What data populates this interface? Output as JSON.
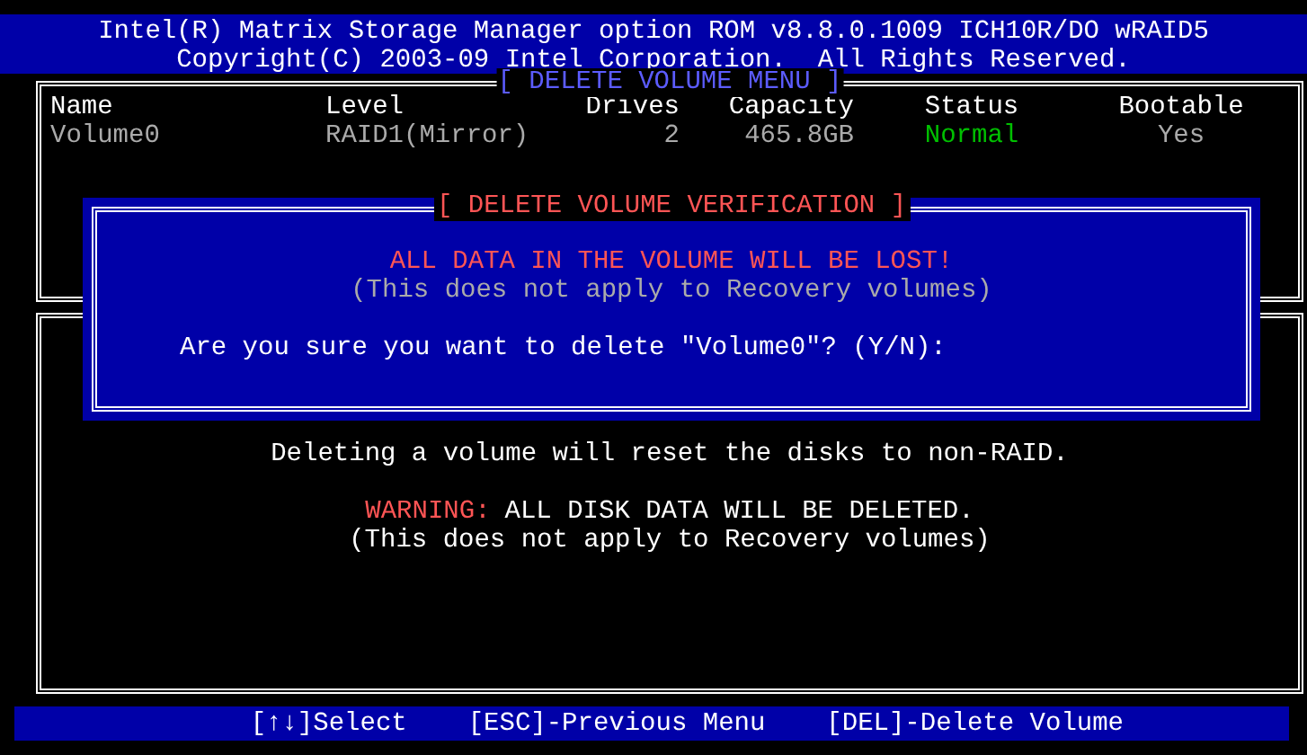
{
  "header": {
    "lines": [
      "Intel(R) Matrix Storage Manager option ROM v8.8.0.1009 ICH10R/DO wRAID5",
      "Copyright(C) 2003-09 Intel Corporation.  All Rights Reserved."
    ]
  },
  "menu": {
    "title": "[ DELETE VOLUME MENU ]",
    "columns": [
      "Name",
      "Level",
      "Drives",
      "Capacity",
      "Status",
      "Bootable"
    ],
    "rows": [
      {
        "cells": [
          "Volume0",
          "RAID1(Mirror)",
          "2",
          "465.8GB",
          "Normal",
          "Yes"
        ],
        "selected": false
      }
    ]
  },
  "dialog": {
    "title": "[ DELETE VOLUME VERIFICATION ]",
    "warning": "ALL DATA IN THE VOLUME WILL BE LOST!",
    "note": "(This does not apply to Recovery volumes)",
    "question": "Are you sure you want to delete \"Volume0\"? (Y/N):"
  },
  "info": {
    "message": "Deleting a volume will reset the disks to non-RAID.",
    "warning_label": "WARNING:",
    "warning_text": "ALL DISK DATA WILL BE DELETED.",
    "note": "(This does not apply to Recovery volumes)"
  },
  "status_bar": [
    "[↑↓]Select",
    "[ESC]-Previous Menu",
    "[DEL]-Delete Volume"
  ]
}
